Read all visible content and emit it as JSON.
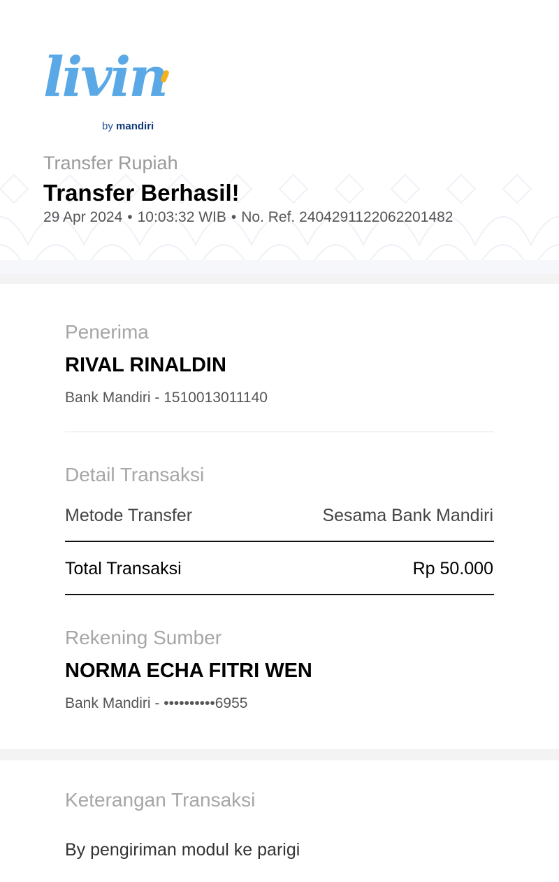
{
  "brand": {
    "logo_word": "livin",
    "logo_by": "by",
    "logo_bank": "mandiri",
    "accent_color": "#5aa9e6",
    "dot_color": "#f3b21b",
    "bank_color": "#0f3a78"
  },
  "header": {
    "category": "Transfer Rupiah",
    "title": "Transfer Berhasil!",
    "date": "29 Apr 2024",
    "time": "10:03:32 WIB",
    "reference": "No. Ref. 2404291122062201482",
    "separator": "•"
  },
  "recipient": {
    "section_label": "Penerima",
    "name": "RIVAL RINALDIN",
    "account": "Bank Mandiri - 1510013011140"
  },
  "transaction_detail": {
    "section_label": "Detail Transaksi",
    "method_label": "Metode Transfer",
    "method_value": "Sesama Bank Mandiri",
    "total_label": "Total Transaksi",
    "total_value": "Rp 50.000"
  },
  "source_account": {
    "section_label": "Rekening Sumber",
    "name": "NORMA ECHA FITRI WEN",
    "account": "Bank Mandiri - ••••••••••6955"
  },
  "notes": {
    "section_label": "Keterangan Transaksi",
    "text": "By pengiriman modul ke parigi"
  }
}
